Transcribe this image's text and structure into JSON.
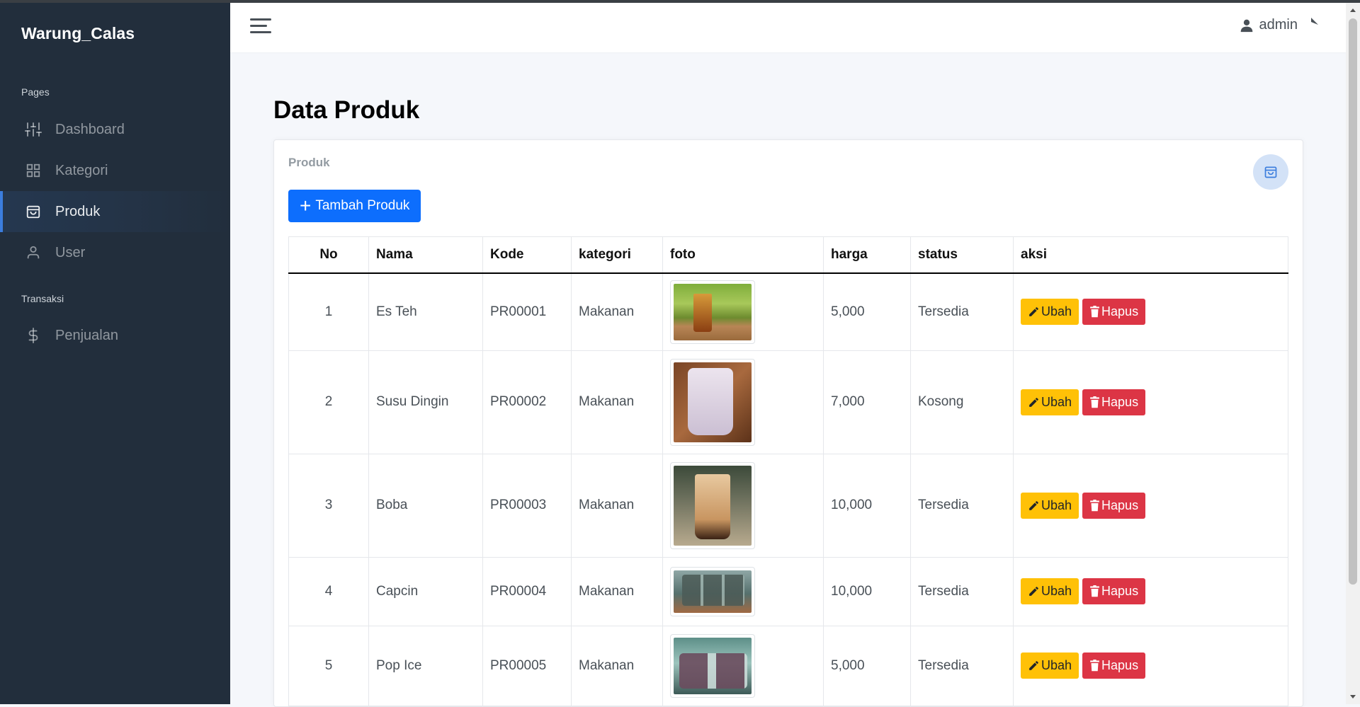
{
  "brand": "Warung_Calas",
  "sidebar": {
    "sections": [
      {
        "label": "Pages"
      },
      {
        "label": "Transaksi"
      }
    ],
    "items": [
      {
        "label": "Dashboard",
        "icon": "sliders-icon"
      },
      {
        "label": "Kategori",
        "icon": "grid-icon"
      },
      {
        "label": "Produk",
        "icon": "shopping-bag-icon",
        "active": true
      },
      {
        "label": "User",
        "icon": "user-icon"
      },
      {
        "label": "Penjualan",
        "icon": "dollar-icon"
      }
    ]
  },
  "header": {
    "user_label": "admin"
  },
  "page": {
    "title_bold": "Data",
    "title_rest": " Produk"
  },
  "card": {
    "title": "Produk",
    "add_button": "Tambah Produk"
  },
  "table": {
    "columns": [
      "No",
      "Nama",
      "Kode",
      "kategori",
      "foto",
      "harga",
      "status",
      "aksi"
    ],
    "rows": [
      {
        "no": "1",
        "nama": "Es Teh",
        "kode": "PR00001",
        "kategori": "Makanan",
        "harga": "5,000",
        "status": "Tersedia"
      },
      {
        "no": "2",
        "nama": "Susu Dingin",
        "kode": "PR00002",
        "kategori": "Makanan",
        "harga": "7,000",
        "status": "Kosong"
      },
      {
        "no": "3",
        "nama": "Boba",
        "kode": "PR00003",
        "kategori": "Makanan",
        "harga": "10,000",
        "status": "Tersedia"
      },
      {
        "no": "4",
        "nama": "Capcin",
        "kode": "PR00004",
        "kategori": "Makanan",
        "harga": "10,000",
        "status": "Tersedia"
      },
      {
        "no": "5",
        "nama": "Pop Ice",
        "kode": "PR00005",
        "kategori": "Makanan",
        "harga": "5,000",
        "status": "Tersedia"
      }
    ],
    "edit_label": "Ubah",
    "delete_label": "Hapus"
  },
  "colors": {
    "sidebar_bg": "#222e3c",
    "primary": "#0d6efd",
    "warning": "#ffc107",
    "danger": "#dc3545"
  }
}
